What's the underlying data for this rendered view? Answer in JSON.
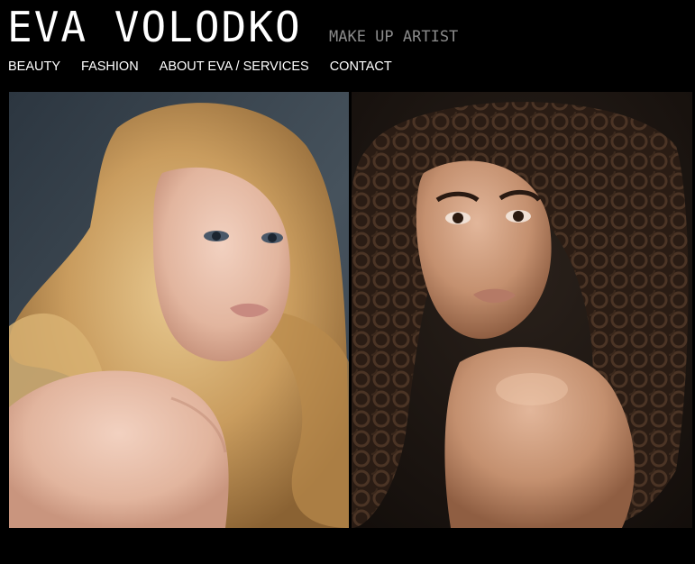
{
  "header": {
    "name": "EVA VOLODKO",
    "tagline": "MAKE UP ARTIST"
  },
  "nav": {
    "items": [
      {
        "label": "BEAUTY"
      },
      {
        "label": "FASHION"
      },
      {
        "label": "ABOUT EVA / SERVICES"
      },
      {
        "label": "CONTACT"
      }
    ]
  },
  "gallery": {
    "photos": [
      {
        "subject": "blonde model portrait",
        "background": "#3f4a55"
      },
      {
        "subject": "curly brunette model portrait",
        "background": "#1a1410"
      }
    ]
  },
  "colors": {
    "page_background": "#000000",
    "brand_text": "#ffffff",
    "tagline_text": "#8a8a8a",
    "nav_text": "#ffffff"
  }
}
